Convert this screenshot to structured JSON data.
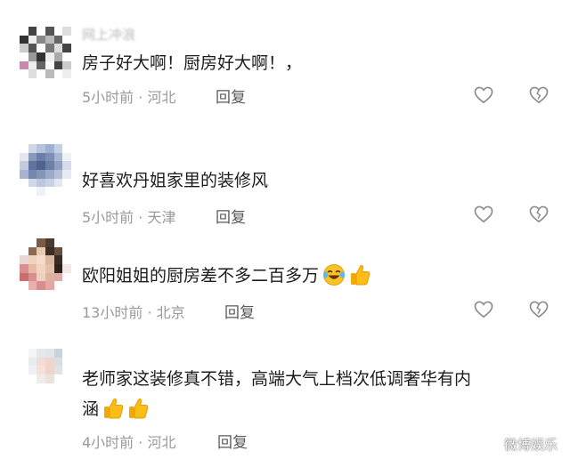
{
  "comments": [
    {
      "name": "网上冲浪",
      "text": "房子好大啊！厨房好大啊！，",
      "time": "5小时前",
      "location": "河北",
      "reply_label": "回复"
    },
    {
      "name": "",
      "text": "好喜欢丹姐家里的装修风",
      "time": "5小时前",
      "location": "天津",
      "reply_label": "回复"
    },
    {
      "name": "",
      "text": "欧阳姐姐的厨房差不多二百多万",
      "time": "13小时前",
      "location": "北京",
      "reply_label": "回复"
    },
    {
      "name": "",
      "text_line1": "老师家这装修真不错，高端大气上档次低调奢华有内",
      "text_line2": "涵",
      "time": "4小时前",
      "location": "河北",
      "reply_label": "回复"
    }
  ],
  "meta_separator": " · ",
  "watermark": "微博娱乐",
  "icons": [
    "like-heart-icon",
    "dislike-broken-heart-icon",
    "laughing-tears-emoji",
    "thumbs-up-emoji"
  ]
}
